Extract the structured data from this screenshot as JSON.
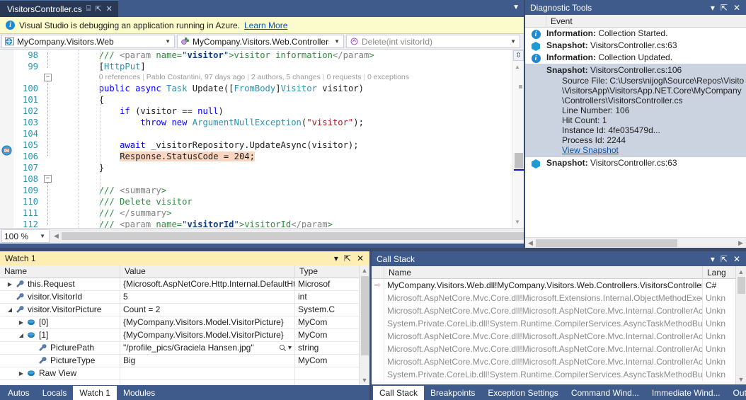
{
  "document_tab": {
    "title": "VisitorsController.cs",
    "pin_icon": "pin-icon",
    "close_icon": "close-icon",
    "dropdown_icon": "chevron-down-icon"
  },
  "azure_banner": {
    "icon": "information-icon",
    "message": "Visual Studio is debugging an application running in Azure.",
    "link": "Learn More"
  },
  "navbar": {
    "project": "MyCompany.Visitors.Web",
    "project_icon": "globe-icon",
    "type": "MyCompany.Visitors.Web.Controllers.\\",
    "type_icon": "class-icon",
    "member": "Delete(int visitorId)",
    "member_icon": "method-icon",
    "arrow": "▾"
  },
  "editor": {
    "zoom": "100 %",
    "codelens": {
      "references": "0 references",
      "author": "Pablo Costantini, 97 days ago",
      "changes": "2 authors, 5 changes",
      "requests": "0 requests",
      "exceptions": "0 exceptions"
    },
    "lines": [
      {
        "n": "98",
        "text": "        /// <param name=\"visitor\">visitor information</param>"
      },
      {
        "n": "99",
        "text": "        [HttpPut]"
      },
      {
        "n": "100",
        "text": "        public async Task Update([FromBody]Visitor visitor)"
      },
      {
        "n": "101",
        "text": "        {"
      },
      {
        "n": "102",
        "text": "            if (visitor == null)"
      },
      {
        "n": "103",
        "text": "                throw new ArgumentNullException(\"visitor\");"
      },
      {
        "n": "104",
        "text": ""
      },
      {
        "n": "105",
        "text": "            await _visitorRepository.UpdateAsync(visitor);"
      },
      {
        "n": "106",
        "text": "            Response.StatusCode = 204;"
      },
      {
        "n": "107",
        "text": "        }"
      },
      {
        "n": "108",
        "text": ""
      },
      {
        "n": "109",
        "text": "        /// <summary>"
      },
      {
        "n": "110",
        "text": "        /// Delete visitor"
      },
      {
        "n": "111",
        "text": "        /// </summary>"
      },
      {
        "n": "112",
        "text": "        /// <param name=\"visitorId\">visitorId</param>"
      }
    ],
    "current_line": "106",
    "breakpoint_glyph_line": "106",
    "breakpoint_glyph_name": "snappoint-icon"
  },
  "diagnostic_tools": {
    "title": "Diagnostic Tools",
    "dropdown_icon": "chevron-down-icon",
    "pin_icon": "pin-icon",
    "close_icon": "close-icon",
    "column_header": "Event",
    "events": [
      {
        "icon": "information-icon",
        "label": "Information:",
        "text": " Collection Started."
      },
      {
        "icon": "snapshot-icon",
        "label": "Snapshot:",
        "text": " VisitorsController.cs:63"
      },
      {
        "icon": "information-icon",
        "label": "Information:",
        "text": " Collection Updated."
      },
      {
        "icon": "snapshot-icon",
        "label": "Snapshot:",
        "text": " VisitorsController.cs:106",
        "selected": true
      },
      {
        "icon": "snapshot-icon",
        "label": "Snapshot:",
        "text": " VisitorsController.cs:63"
      }
    ],
    "selected_detail": {
      "source_file_1": "Source File: C:\\Users\\nijogl\\Source\\Repos\\Visito",
      "source_file_2": "\\VisitorsApp\\VisitorsApp.NET.Core\\MyCompany",
      "source_file_3": "\\Controllers\\VisitorsController.cs",
      "line_number": "Line Number: 106",
      "hit_count": "Hit Count: 1",
      "instance_id": "Instance Id: 4fe035479d...",
      "process_id": "Process Id: 2244",
      "view_link": "View Snapshot"
    }
  },
  "watch": {
    "title": "Watch 1",
    "dropdown_icon": "chevron-down-icon",
    "pin_icon": "pin-icon",
    "close_icon": "close-icon",
    "columns": [
      "Name",
      "Value",
      "Type"
    ],
    "rows": [
      {
        "indent": 0,
        "expander": "collapsed",
        "icon": "wrench-icon",
        "name": "this.Request",
        "value": "{Microsoft.AspNetCore.Http.Internal.DefaultHttpReque",
        "type": "Microsof"
      },
      {
        "indent": 0,
        "expander": "none",
        "icon": "wrench-icon",
        "name": "visitor.VisitorId",
        "value": "5",
        "type": "int"
      },
      {
        "indent": 0,
        "expander": "expanded",
        "icon": "wrench-icon",
        "name": "visitor.VisitorPicture",
        "value": "Count = 2",
        "type": "System.C"
      },
      {
        "indent": 1,
        "expander": "collapsed",
        "icon": "collection-item-icon",
        "name": "[0]",
        "value": "{MyCompany.Visitors.Model.VisitorPicture}",
        "type": "MyCom"
      },
      {
        "indent": 1,
        "expander": "expanded",
        "icon": "collection-item-icon",
        "name": "[1]",
        "value": "{MyCompany.Visitors.Model.VisitorPicture}",
        "type": "MyCom"
      },
      {
        "indent": 2,
        "expander": "none",
        "icon": "wrench-icon",
        "name": "PicturePath",
        "value": "\"/profile_pics/Graciela Hansen.jpg\"",
        "type": "string",
        "magnifier": true
      },
      {
        "indent": 2,
        "expander": "none",
        "icon": "wrench-icon",
        "name": "PictureType",
        "value": "Big",
        "type": "MyCom"
      },
      {
        "indent": 1,
        "expander": "collapsed",
        "icon": "collection-item-icon",
        "name": "Raw View",
        "value": "",
        "type": ""
      }
    ],
    "tabs": [
      {
        "label": "Autos",
        "selected": false
      },
      {
        "label": "Locals",
        "selected": false
      },
      {
        "label": "Watch 1",
        "selected": true
      },
      {
        "label": "Modules",
        "selected": false
      }
    ]
  },
  "call_stack": {
    "title": "Call Stack",
    "dropdown_icon": "chevron-down-icon",
    "pin_icon": "pin-icon",
    "close_icon": "close-icon",
    "columns": [
      "Name",
      "Lang"
    ],
    "rows": [
      {
        "current": true,
        "name": "MyCompany.Visitors.Web.dll!MyCompany.Visitors.Web.Controllers.VisitorsController.",
        "lang": "C#"
      },
      {
        "current": false,
        "name": "Microsoft.AspNetCore.Mvc.Core.dll!Microsoft.Extensions.Internal.ObjectMethodExecu",
        "lang": "Unkn"
      },
      {
        "current": false,
        "name": "Microsoft.AspNetCore.Mvc.Core.dll!Microsoft.AspNetCore.Mvc.Internal.ControllerAct",
        "lang": "Unkn"
      },
      {
        "current": false,
        "name": "System.Private.CoreLib.dll!System.Runtime.CompilerServices.AsyncTaskMethodBuilde",
        "lang": "Unkn"
      },
      {
        "current": false,
        "name": "Microsoft.AspNetCore.Mvc.Core.dll!Microsoft.AspNetCore.Mvc.Internal.ControllerAct",
        "lang": "Unkn"
      },
      {
        "current": false,
        "name": "Microsoft.AspNetCore.Mvc.Core.dll!Microsoft.AspNetCore.Mvc.Internal.ControllerAct",
        "lang": "Unkn"
      },
      {
        "current": false,
        "name": "Microsoft.AspNetCore.Mvc.Core.dll!Microsoft.AspNetCore.Mvc.Internal.ControllerAct",
        "lang": "Unkn"
      },
      {
        "current": false,
        "name": "System.Private.CoreLib.dll!System.Runtime.CompilerServices.AsyncTaskMethodBuilde",
        "lang": "Unkn"
      }
    ],
    "tabs": [
      {
        "label": "Call Stack",
        "selected": true
      },
      {
        "label": "Breakpoints",
        "selected": false
      },
      {
        "label": "Exception Settings",
        "selected": false
      },
      {
        "label": "Command Wind...",
        "selected": false
      },
      {
        "label": "Immediate Wind...",
        "selected": false
      },
      {
        "label": "Output",
        "selected": false
      }
    ]
  },
  "colors": {
    "chrome": "#3e5b8c",
    "banner": "#fcfbcc",
    "accent_link": "#0d54a8",
    "snapshot": "#1f9ad6",
    "current_line_highlight": "#fad6c0",
    "watch_caption": "#ffeeb4"
  }
}
